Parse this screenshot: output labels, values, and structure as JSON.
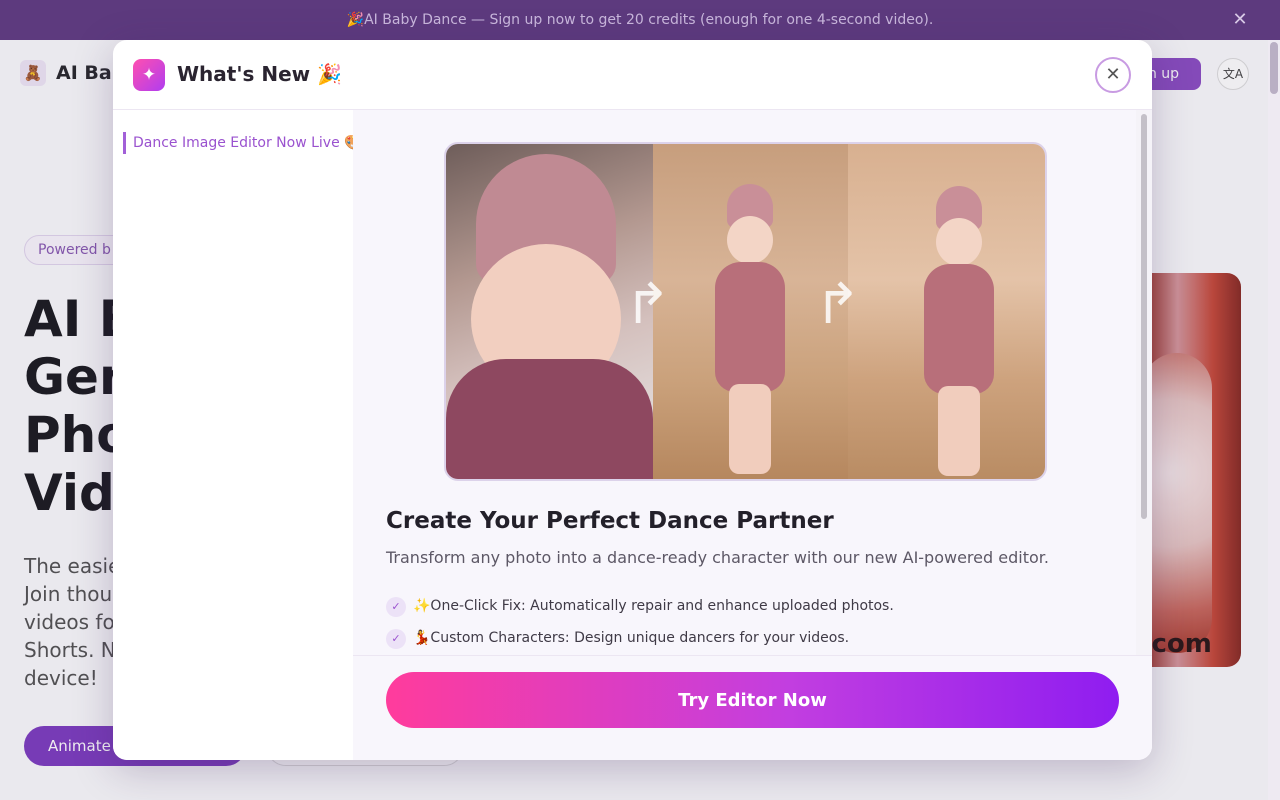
{
  "banner": {
    "text": "🎉AI Baby Dance — Sign up now to get 20 credits (enough for one 4-second video).",
    "close_glyph": "✕"
  },
  "background_page": {
    "logo_glyph": "🧸",
    "brand": "AI Bab",
    "signup_label": "n up",
    "lang_glyph": "文A",
    "powered_label": "Powered b",
    "hero_title_lines": [
      "AI B",
      "Gen",
      "Pho",
      "Vide"
    ],
    "hero_desc_lines": [
      "The easie",
      "Join thou",
      "videos fo",
      "Shorts. N",
      "device!"
    ],
    "animate_label": "Animate",
    "media_caption": "e.com"
  },
  "modal": {
    "icon_glyph": "✦",
    "title": "What's New 🎉",
    "close_glyph": "✕",
    "sidebar": {
      "items": [
        {
          "label": "Dance Image Editor Now Live 🎨"
        }
      ]
    },
    "content": {
      "title": "Create Your Perfect Dance Partner",
      "subtitle": "Transform any photo into a dance-ready character with our new AI-powered editor.",
      "arrow_glyph": "↱",
      "features": [
        {
          "check_glyph": "✓",
          "text": "✨One-Click Fix: Automatically repair and enhance uploaded photos."
        },
        {
          "check_glyph": "✓",
          "text": "💃Custom Characters: Design unique dancers for your videos."
        }
      ]
    },
    "cta_label": "Try Editor Now"
  },
  "colors": {
    "banner_bg": "#5d3a7e",
    "accent": "#9a52cf",
    "cta_gradient_start": "#ff3c9c",
    "cta_gradient_end": "#8f1df0"
  },
  "icons": [
    "party-icon",
    "close-icon",
    "sparkle-icon",
    "translate-icon",
    "check-icon",
    "arrow-redo-icon"
  ]
}
